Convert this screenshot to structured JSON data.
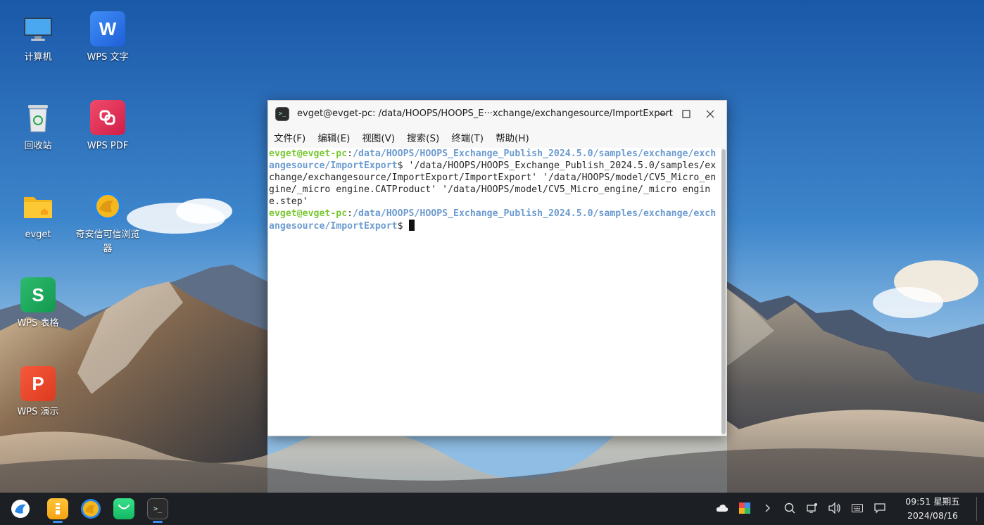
{
  "desktop": {
    "icons": [
      {
        "label": "计算机",
        "icon": "computer-icon"
      },
      {
        "label": "WPS 文字",
        "icon": "wps-writer-icon",
        "glyph": "W"
      },
      {
        "label": "回收站",
        "icon": "trash-icon"
      },
      {
        "label": "WPS PDF",
        "icon": "wps-pdf-icon"
      },
      {
        "label": "evget",
        "icon": "folder-icon"
      },
      {
        "label": "奇安信可信浏览器",
        "icon": "browser-icon"
      },
      {
        "label": "WPS 表格",
        "icon": "wps-spreadsheet-icon",
        "glyph": "S"
      },
      {
        "label": "WPS 演示",
        "icon": "wps-presentation-icon",
        "glyph": "P"
      }
    ]
  },
  "terminal": {
    "title": "evget@evget-pc: /data/HOOPS/HOOPS_E···xchange/exchangesource/ImportExport",
    "menu": [
      "文件(F)",
      "编辑(E)",
      "视图(V)",
      "搜索(S)",
      "终端(T)",
      "帮助(H)"
    ],
    "lines": [
      {
        "user": "evget@evget-pc",
        "path": "/data/HOOPS/HOOPS_Exchange_Publish_2024.5.0/samples/exchange/exchangesource/ImportExport",
        "prompt": "$ ",
        "command": "'/data/HOOPS/HOOPS_Exchange_Publish_2024.5.0/samples/exchange/exchangesource/ImportExport/ImportExport' '/data/HOOPS/model/CV5_Micro_engine/_micro engine.CATProduct' '/data/HOOPS/model/CV5_Micro_engine/_micro engine.step'"
      },
      {
        "user": "evget@evget-pc",
        "path": "/data/HOOPS/HOOPS_Exchange_Publish_2024.5.0/samples/exchange/exchangesource/ImportExport",
        "prompt": "$ ",
        "command": ""
      }
    ]
  },
  "taskbar": {
    "apps": [
      "launcher-icon",
      "file-manager-icon",
      "browser-icon",
      "store-icon",
      "terminal-icon"
    ],
    "tray": [
      "cloud-icon",
      "app-tray-icon",
      "chevron-right-icon",
      "search-icon",
      "network-icon",
      "volume-icon",
      "keyboard-icon",
      "notification-icon"
    ],
    "time": "09:51 星期五",
    "date": "2024/08/16"
  },
  "colors": {
    "prompt_user": "#78c832",
    "prompt_path": "#6c9bd0",
    "taskbar_bg": "#1c1f24",
    "active_indicator": "#3d8ef0"
  }
}
